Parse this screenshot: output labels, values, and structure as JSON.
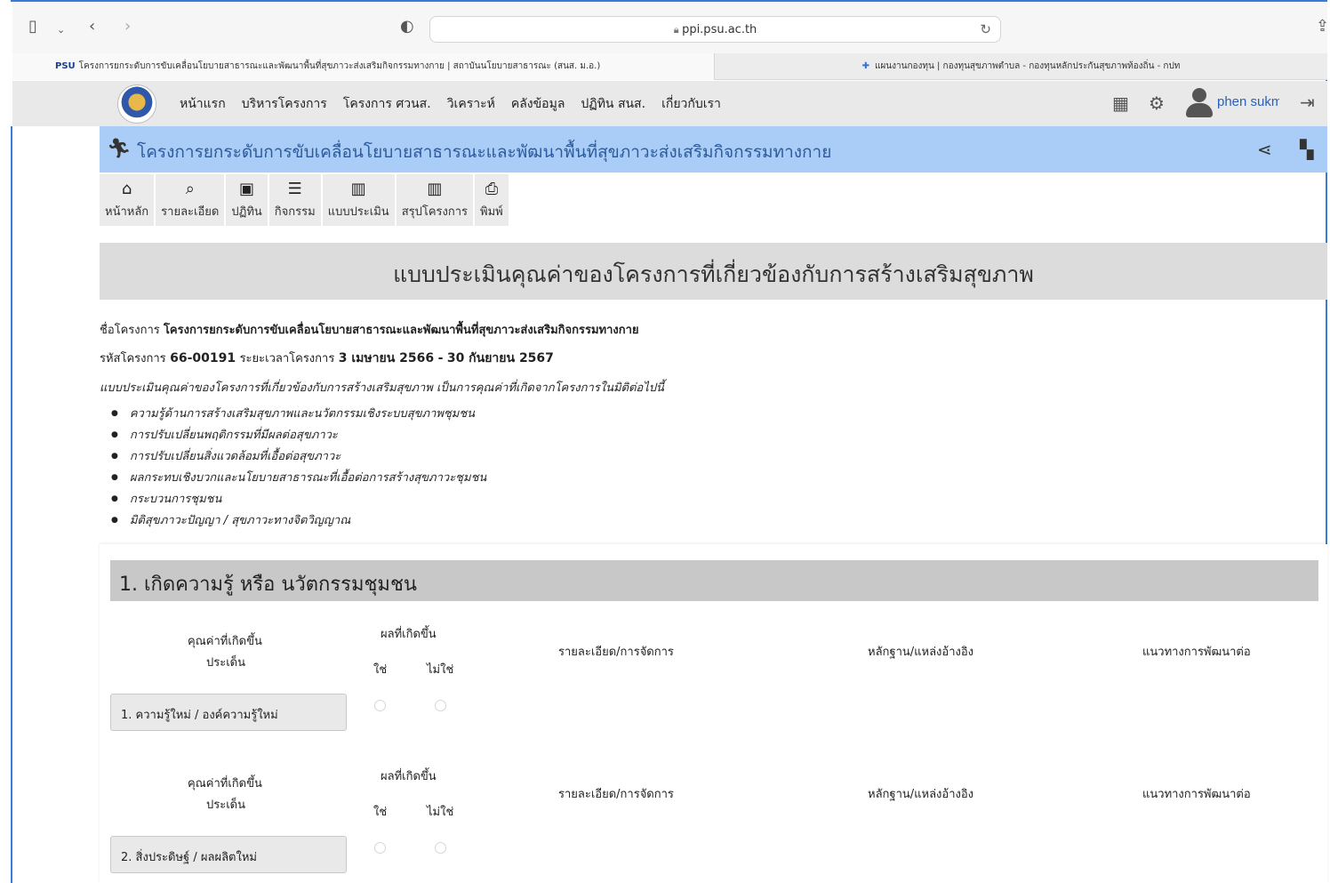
{
  "browser": {
    "url": "ppi.psu.ac.th",
    "tabs": [
      {
        "favicon": "PSU",
        "title": "โครงการยกระดับการขับเคลื่อนโยบายสาธารณะและพัฒนาพื้นที่สุขภาวะส่งเสริมกิจกรรมทางกาย | สถาบันนโยบายสาธารณะ (สนส. ม.อ.)"
      },
      {
        "favicon": "puzzle-icon",
        "title": "แผนงานกองทุน | กองทุนสุขภาพตำบล - กองทุนหลักประกันสุขภาพท้องถิ่น - กปท"
      }
    ]
  },
  "header": {
    "nav": [
      "หน้าแรก",
      "บริหารโครงการ",
      "โครงการ ศวนส.",
      "วิเคราะห์",
      "คลังข้อมูล",
      "ปฏิทิน สนส.",
      "เกี่ยวกับเรา"
    ],
    "username": "phen sukm"
  },
  "banner": {
    "title": "โครงการยกระดับการขับเคลื่อนโยบายสาธารณะและพัฒนาพื้นที่สุขภาวะส่งเสริมกิจกรรมทางกาย"
  },
  "toolbar": [
    {
      "icon": "home-icon",
      "label": "หน้าหลัก"
    },
    {
      "icon": "search-doc-icon",
      "label": "รายละเอียด"
    },
    {
      "icon": "calendar-icon",
      "label": "ปฏิทิน"
    },
    {
      "icon": "clipboard-icon",
      "label": "กิจกรรม"
    },
    {
      "icon": "chart-icon",
      "label": "แบบประเมิน"
    },
    {
      "icon": "chart-icon",
      "label": "สรุปโครงการ"
    },
    {
      "icon": "printer-icon",
      "label": "พิมพ์"
    }
  ],
  "form": {
    "title": "แบบประเมินคุณค่าของโครงการที่เกี่ยวข้องกับการสร้างเสริมสุขภาพ",
    "project_name_label": "ชื่อโครงการ",
    "project_name": "โครงการยกระดับการขับเคลื่อนโยบายสาธารณะและพัฒนาพื้นที่สุขภาวะส่งเสริมกิจกรรมทางกาย",
    "project_code_label": "รหัสโครงการ",
    "project_code": "66-00191",
    "period_label": "ระยะเวลาโครงการ",
    "period_start": "3 เมษายน 2566",
    "period_sep": "-",
    "period_end": "30 กันยายน 2567",
    "intro": "แบบประเมินคุณค่าของโครงการที่เกี่ยวข้องกับการสร้างเสริมสุขภาพ เป็นการคุณค่าที่เกิดจากโครงการในมิติต่อไปนี้",
    "dimensions": [
      "ความรู้ด้านการสร้างเสริมสุขภาพและนวัตกรรมเชิงระบบสุขภาพชุมชน",
      "การปรับเปลี่ยนพฤติกรรมที่มีผลต่อสุขภาวะ",
      "การปรับเปลี่ยนสิ่งแวดล้อมที่เอื้อต่อสุขภาวะ",
      "ผลกระทบเชิงบวกและนโยบายสาธารณะที่เอื้อต่อการสร้างสุขภาวะชุมชน",
      "กระบวนการชุมชน",
      "มิติสุขภาวะปัญญา / สุขภาวะทางจิตวิญญาณ"
    ]
  },
  "section": {
    "title": "1. เกิดความรู้ หรือ นวัตกรรมชุมชน",
    "columns": {
      "value": "คุณค่าที่เกิดขึ้น",
      "issue": "ประเด็น",
      "result": "ผลที่เกิดขึ้น",
      "yes": "ใช่",
      "no": "ไม่ใช่",
      "detail": "รายละเอียด/การจัดการ",
      "evidence": "หลักฐาน/แหล่งอ้างอิง",
      "development": "แนวทางการพัฒนาต่อ"
    },
    "items": [
      {
        "issue": "1. ความรู้ใหม่ / องค์ความรู้ใหม่"
      },
      {
        "issue": "2. สิ่งประดิษฐ์ / ผลผลิตใหม่"
      }
    ]
  }
}
